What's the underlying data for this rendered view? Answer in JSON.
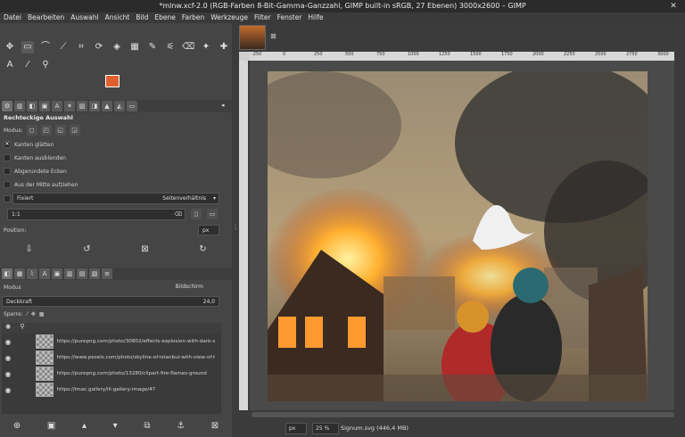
{
  "window": {
    "title": "*mlnw.xcf-2.0 (RGB-Farben 8-Bit-Gamma-Ganzzahl, GIMP built-in sRGB, 27 Ebenen) 3000x2600 – GIMP",
    "close": "✕"
  },
  "menu": [
    "Datei",
    "Bearbeiten",
    "Auswahl",
    "Ansicht",
    "Bild",
    "Ebene",
    "Farben",
    "Werkzeuge",
    "Filter",
    "Fenster",
    "Hilfe"
  ],
  "colors": {
    "foreground": "#e06030",
    "background": "#ffffff"
  },
  "tool_options": {
    "title": "Rechteckige Auswahl",
    "mode_label": "Modus:",
    "smooth_edges": "Kanten glätten",
    "feather_edges": "Kanten ausblenden",
    "rounded_corners": "Abgerundete Ecken",
    "expand_from_center": "Aus der Mitte aufziehen",
    "fixed_label": "Fixiert",
    "fixed_option": "Seitenverhältnis",
    "ratio_value": "1:1",
    "position_label": "Position:",
    "unit": "px"
  },
  "layers": {
    "mode_label": "Modus",
    "mode_value": "Bildschirm",
    "opacity_label": "Deckkraft",
    "opacity_value": "24,0",
    "lock_label": "Sperre:",
    "items": [
      {
        "name": "https://purepng.com/photo/30802/effects-explosion-with-dark-s"
      },
      {
        "name": "https://www.pexels.com/photo/skyline-of-istanbul-with-view-of-t"
      },
      {
        "name": "https://purepng.com/photo/13280/clipart-fire-flames-ground"
      },
      {
        "name": "https://imac.gallery/lil-gallery-image/47"
      }
    ]
  },
  "status": {
    "unit": "px",
    "zoom": "25 %",
    "info": "Signum.svg (446,4 MB)"
  },
  "ruler_ticks": [
    "-250",
    "0",
    "250",
    "500",
    "750",
    "1000",
    "1250",
    "1500",
    "1750",
    "2000",
    "2250",
    "2500",
    "2750",
    "3000"
  ]
}
